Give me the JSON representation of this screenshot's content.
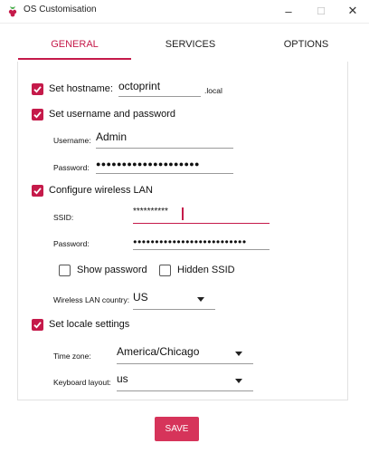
{
  "window": {
    "title": "OS Customisation",
    "minimize_icon": "–",
    "maximize_icon": "☐",
    "close_icon": "✕"
  },
  "tabs": [
    {
      "label": "GENERAL",
      "active": true
    },
    {
      "label": "SERVICES",
      "active": false
    },
    {
      "label": "OPTIONS",
      "active": false
    }
  ],
  "general": {
    "hostname": {
      "checked": true,
      "label": "Set hostname:",
      "value": "octoprint",
      "suffix": ".local"
    },
    "user": {
      "checked": true,
      "label": "Set username and password",
      "username_label": "Username:",
      "username_value": "Admin",
      "password_label": "Password:",
      "password_value": "●●●●●●●●●●●●●●●●●●●●"
    },
    "wifi": {
      "checked": true,
      "label": "Configure wireless LAN",
      "ssid_label": "SSID:",
      "ssid_value": "**********",
      "password_label": "Password:",
      "password_value": "●●●●●●●●●●●●●●●●●●●●●●●●●●",
      "show_password": {
        "checked": false,
        "label": "Show password"
      },
      "hidden_ssid": {
        "checked": false,
        "label": "Hidden SSID"
      },
      "country_label": "Wireless LAN country:",
      "country_value": "US"
    },
    "locale": {
      "checked": true,
      "label": "Set locale settings",
      "timezone_label": "Time zone:",
      "timezone_value": "America/Chicago",
      "keyboard_label": "Keyboard layout:",
      "keyboard_value": "us"
    }
  },
  "footer": {
    "save_label": "SAVE"
  },
  "colors": {
    "accent": "#c51a4a",
    "button": "#d6345a"
  }
}
